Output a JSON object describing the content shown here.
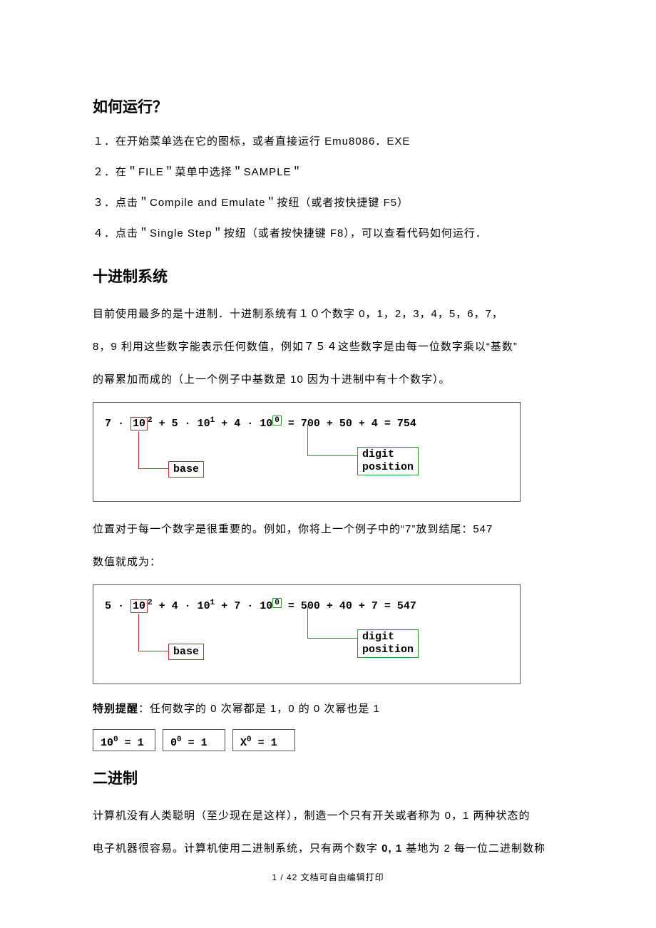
{
  "s1": {
    "h": "如何运行？",
    "li1": "１．在开始菜单选在它的图标，或者直接运行 Emu8086．EXE",
    "li2": "２．在＂FILE＂菜单中选择＂SAMPLE＂",
    "li3": "３．点击＂Compile and Emulate＂按纽（或者按快捷键 F5）",
    "li4": "４．点击＂Single Step＂按纽（或者按快捷键 F8），可以查看代码如何运行．"
  },
  "s2": {
    "h": "十进制系统",
    "p1": "目前使用最多的是十进制．十进制系统有１０个数字 0，1，2，3，4，5，6，7，",
    "p2a": "8，9  利用这些数字能表示任何数值，例如７５４这些数字是由每一位数字乘以",
    "p2b": "“基数”",
    "p3": "的幂累加而成的（上一个例子中基数是 10  因为十进制中有十个数字）。"
  },
  "d1": {
    "a": "7 · ",
    "b": "10",
    "e2": "2",
    "c": "  +  5 · 10",
    "e1": "1",
    "d": "  +  4 · 10",
    "e0": "0",
    "rhs": "   =   700 + 50 + 4 = 754",
    "base": "base",
    "pos1": "digit",
    "pos2": "position"
  },
  "s3": {
    "p1": "位置对于每一个数字是很重要的。例如，你将上一个例子中的“7”放到结尾：547",
    "p2": "数值就成为："
  },
  "d2": {
    "a": "5 · ",
    "b": "10",
    "e2": "2",
    "c": "  +  4 · 10",
    "e1": "1",
    "d": "  +  7 · 10",
    "e0": "0",
    "rhs": "   =   500 + 40 + 7 = 547",
    "base": "base",
    "pos1": "digit",
    "pos2": "position"
  },
  "s4": {
    "lbl": "特别提醒",
    "txt": "：任何数字的 0 次幂都是 1，0 的 0 次幂也是 1"
  },
  "sb": {
    "b1a": "10",
    "b1s": "0",
    "b1r": " =  1",
    "b2a": "0",
    "b2s": "0",
    "b2r": " =  1",
    "b3a": "X",
    "b3s": "0",
    "b3r": " =  1"
  },
  "s5": {
    "h": "二进制",
    "p1": "计算机没有人类聪明（至少现在是这样），制造一个只有开关或者称为 0，1 两种状态的",
    "p2a": "电子机器很容易。计算机使用二进制系统，只有两个数字 ",
    "p2b": "0, 1",
    "p2c": " 基地为 2 每一位二进制数称"
  },
  "footer": "1 / 42 文档可自由编辑打印"
}
